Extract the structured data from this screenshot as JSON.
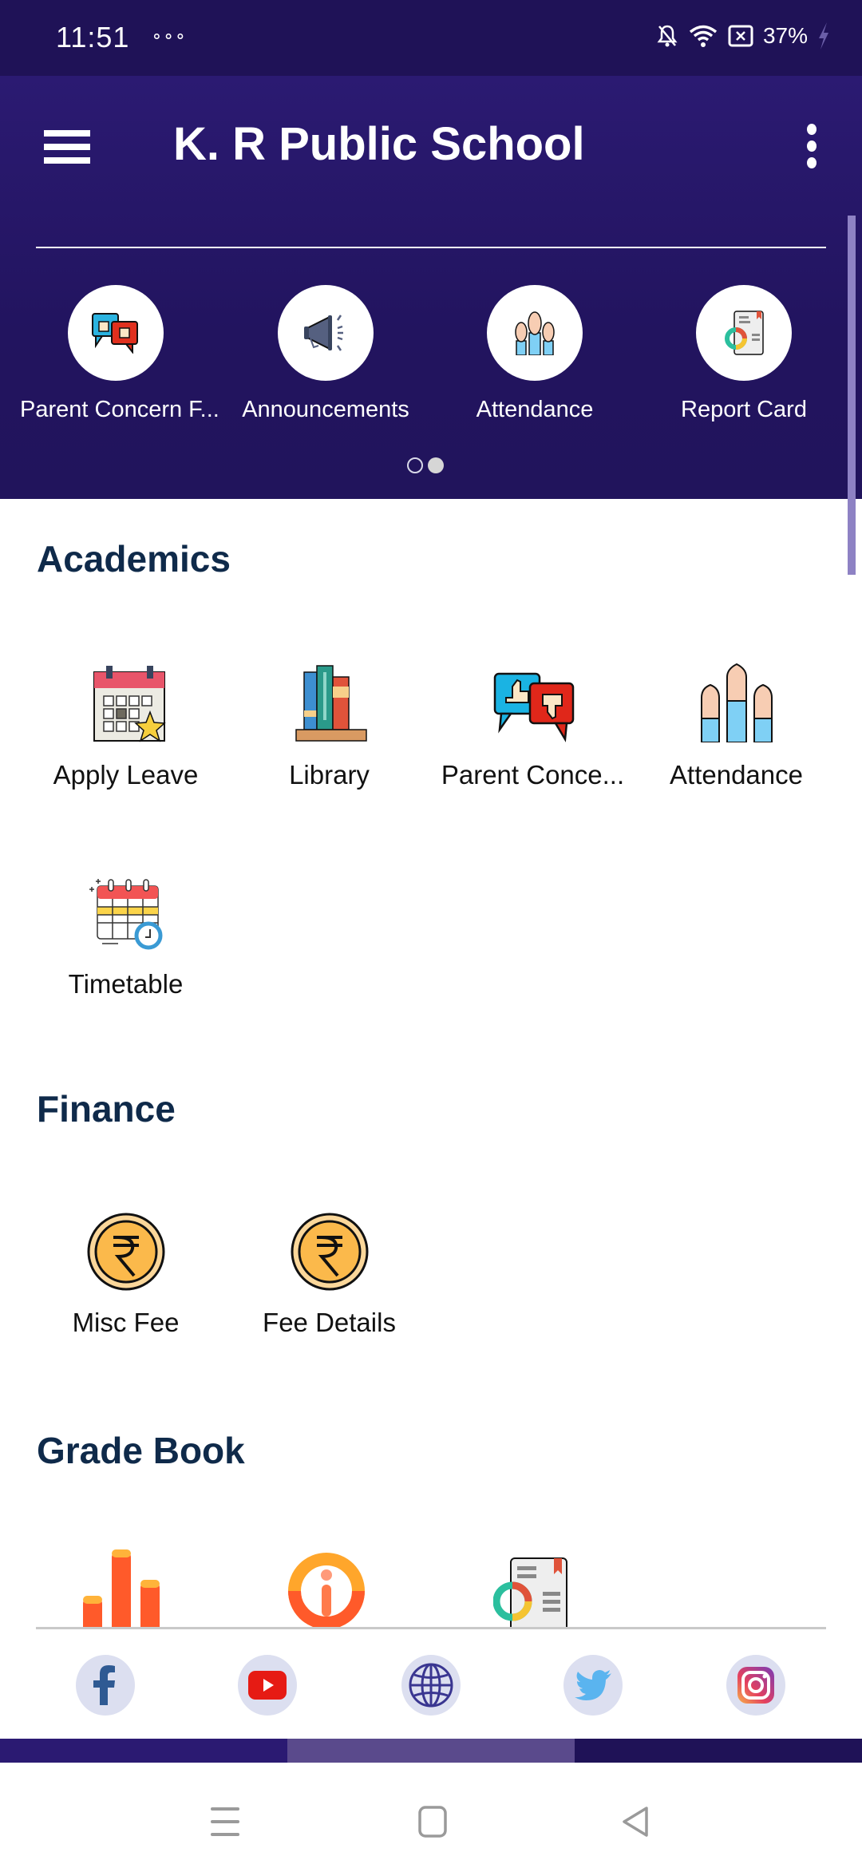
{
  "status_bar": {
    "time": "11:51",
    "notification_dots": "ooo",
    "battery_percent": "37%",
    "icons": [
      "bell-off-icon",
      "wifi-icon",
      "battery-saver-icon",
      "charging-bolt-icon"
    ]
  },
  "app_bar": {
    "title": "K. R Public School",
    "menu_icon": "hamburger-icon",
    "overflow_icon": "more-vert-icon"
  },
  "quick_access": {
    "items": [
      {
        "label": "Parent Concern F...",
        "icon": "parent-concern-icon"
      },
      {
        "label": "Announcements",
        "icon": "megaphone-icon"
      },
      {
        "label": "Attendance",
        "icon": "raised-hands-icon"
      },
      {
        "label": "Report Card",
        "icon": "report-card-icon"
      }
    ],
    "pages": 2,
    "active_page": 2
  },
  "sections": {
    "academics": {
      "title": "Academics",
      "items": [
        {
          "label": "Apply Leave",
          "icon": "calendar-star-icon"
        },
        {
          "label": "Library",
          "icon": "books-icon"
        },
        {
          "label": "Parent Conce...",
          "icon": "parent-concern-icon"
        },
        {
          "label": "Attendance",
          "icon": "raised-hands-icon"
        },
        {
          "label": "Timetable",
          "icon": "calendar-clock-icon"
        }
      ]
    },
    "finance": {
      "title": "Finance",
      "items": [
        {
          "label": "Misc Fee",
          "icon": "rupee-coin-icon"
        },
        {
          "label": "Fee Details",
          "icon": "rupee-coin-icon"
        }
      ]
    },
    "grade_book": {
      "title": "Grade Book",
      "items": [
        {
          "icon": "bar-chart-icon"
        },
        {
          "icon": "info-icon"
        },
        {
          "icon": "report-card-icon"
        }
      ]
    }
  },
  "social": [
    {
      "name": "facebook",
      "icon": "facebook-icon"
    },
    {
      "name": "youtube",
      "icon": "youtube-icon"
    },
    {
      "name": "website",
      "icon": "globe-icon"
    },
    {
      "name": "twitter",
      "icon": "twitter-icon"
    },
    {
      "name": "instagram",
      "icon": "instagram-icon"
    }
  ],
  "bottom_tabs": {
    "count": 3,
    "active_index": 1
  },
  "nav_bar": [
    "recents-icon",
    "home-icon",
    "back-icon"
  ],
  "colors": {
    "primary": "#2a1a70",
    "status_bar": "#1f1257",
    "heading": "#0f2a4a",
    "active_tab": "#5a4a8c"
  }
}
